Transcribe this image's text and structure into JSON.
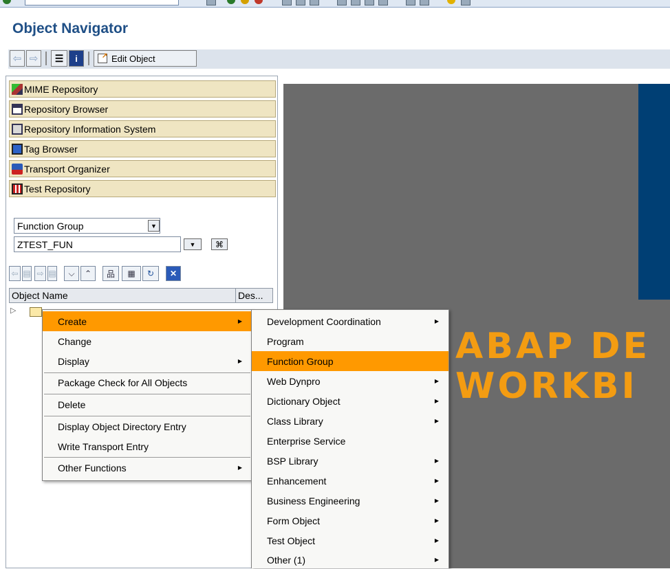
{
  "window": {
    "title": "Object Navigator"
  },
  "toolbar": {
    "edit_object_label": "Edit Object"
  },
  "nav_buttons": [
    {
      "label": "MIME Repository",
      "icon": "mime-repository-icon"
    },
    {
      "label": "Repository Browser",
      "icon": "repository-browser-icon"
    },
    {
      "label": "Repository Information System",
      "icon": "repository-info-system-icon"
    },
    {
      "label": "Tag Browser",
      "icon": "tag-browser-icon"
    },
    {
      "label": "Transport Organizer",
      "icon": "transport-organizer-icon"
    },
    {
      "label": "Test Repository",
      "icon": "test-repository-icon"
    }
  ],
  "object_type": {
    "value": "Function Group"
  },
  "object_name": {
    "value": "ZTEST_FUN"
  },
  "tree": {
    "col_object_name": "Object Name",
    "col_description": "Des..."
  },
  "context_menu": {
    "items": [
      {
        "label": "Create",
        "submenu": true,
        "active": true
      },
      {
        "label": "Change",
        "submenu": false
      },
      {
        "label": "Display",
        "submenu": true
      },
      {
        "label": "Package Check for All Objects",
        "submenu": false
      },
      {
        "label": "Delete",
        "submenu": false
      },
      {
        "label": "Display Object Directory Entry",
        "submenu": false
      },
      {
        "label": "Write Transport Entry",
        "submenu": false
      },
      {
        "label": "Other Functions",
        "submenu": true
      }
    ]
  },
  "create_submenu": {
    "items": [
      {
        "label": "Development Coordination",
        "submenu": true
      },
      {
        "label": "Program",
        "submenu": false
      },
      {
        "label": "Function Group",
        "submenu": false,
        "active": true
      },
      {
        "label": "Web Dynpro",
        "submenu": true
      },
      {
        "label": "Dictionary Object",
        "submenu": true
      },
      {
        "label": "Class Library",
        "submenu": true
      },
      {
        "label": "Enterprise Service",
        "submenu": false
      },
      {
        "label": "BSP Library",
        "submenu": true
      },
      {
        "label": "Enhancement",
        "submenu": true
      },
      {
        "label": "Business Engineering",
        "submenu": true
      },
      {
        "label": "Form Object",
        "submenu": true
      },
      {
        "label": "Test Object",
        "submenu": true
      },
      {
        "label": "Other (1)",
        "submenu": true
      }
    ]
  },
  "workbench": {
    "line1": "ABAP DE",
    "line2": "WORKBI"
  },
  "colors": {
    "accent": "#ff9900",
    "title": "#1f4f86",
    "nav_button": "#efe5c2",
    "content_bg": "#6b6b6b",
    "splash_blue": "#003f74"
  }
}
